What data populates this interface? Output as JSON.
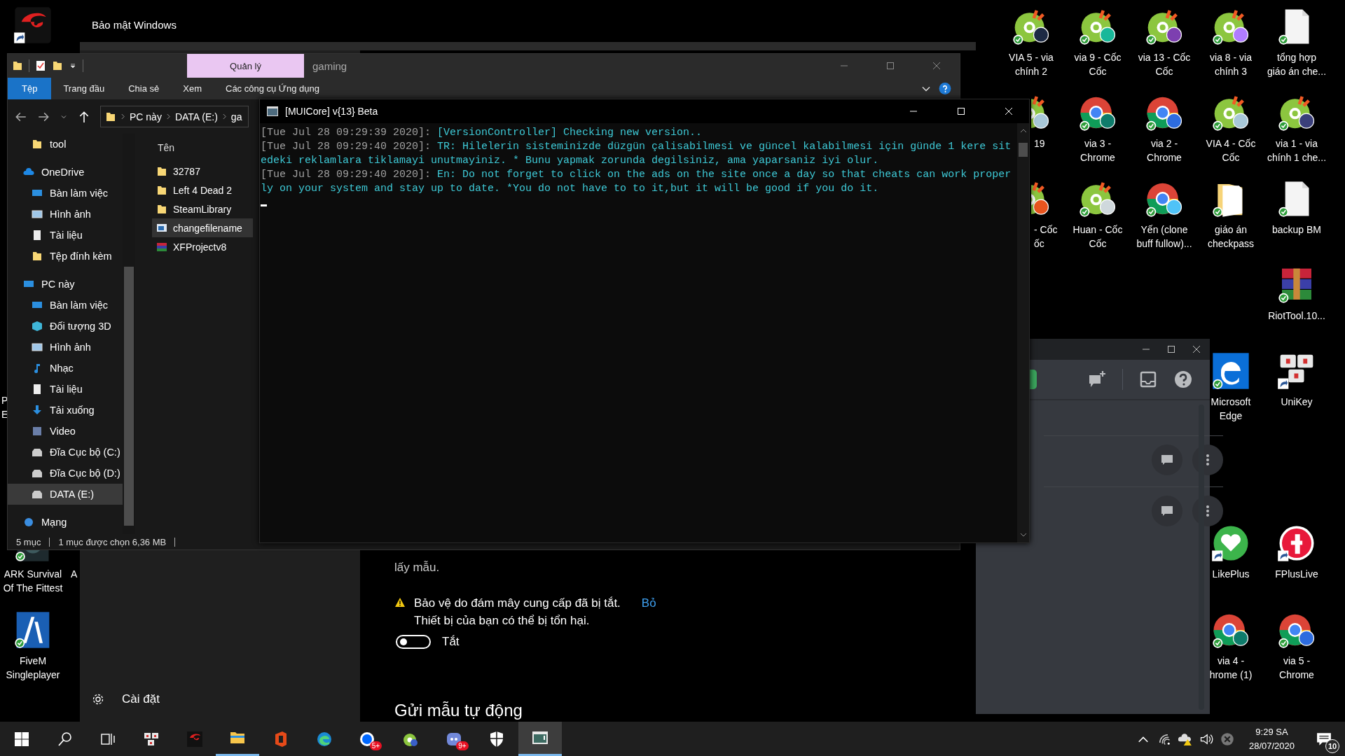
{
  "desktop_icons": [
    {
      "kind": "garena",
      "synced": false,
      "shortcut": true
    },
    {
      "kind": "coccoc",
      "synced": true,
      "shortcut": false,
      "lines": [
        "VIA 5 - via",
        "chính 2"
      ]
    },
    {
      "kind": "coccoc",
      "synced": true,
      "shortcut": false,
      "lines": [
        "via 9 - Cốc",
        "Cốc"
      ]
    },
    {
      "kind": "coccoc",
      "synced": true,
      "shortcut": false,
      "lines": [
        "via 13 - Cốc",
        "Cốc"
      ]
    },
    {
      "kind": "coccoc",
      "synced": true,
      "shortcut": false,
      "lines": [
        "via 8 - via",
        "chính 3"
      ]
    },
    {
      "kind": "doc",
      "synced": true,
      "shortcut": false,
      "lines": [
        "tổng hợp",
        "giáo án che..."
      ]
    },
    {
      "kind": "coccoc",
      "lines": [
        "19"
      ]
    },
    {
      "kind": "chrome",
      "synced": true,
      "shortcut": false,
      "lines": [
        "via 3 -",
        "Chrome"
      ]
    },
    {
      "kind": "chrome",
      "synced": true,
      "shortcut": false,
      "lines": [
        "via 2 -",
        "Chrome"
      ]
    },
    {
      "kind": "coccoc",
      "synced": true,
      "shortcut": false,
      "lines": [
        "VIA 4 - Cốc",
        "Cốc"
      ]
    },
    {
      "kind": "coccoc",
      "synced": true,
      "shortcut": false,
      "lines": [
        "via 1 - via",
        "chính 1 che..."
      ]
    },
    {
      "kind": "coccoc",
      "lines": [
        "- Cốc",
        "ốc"
      ]
    },
    {
      "kind": "coccoc",
      "synced": true,
      "shortcut": false,
      "lines": [
        "Huan - Cốc",
        "Cốc"
      ]
    },
    {
      "kind": "chrome",
      "synced": true,
      "shortcut": false,
      "lines": [
        "Yến (clone",
        "buff fullow)..."
      ]
    },
    {
      "kind": "folder",
      "synced": true,
      "shortcut": false,
      "lines": [
        "giáo án",
        "checkpass"
      ]
    },
    {
      "kind": "doc",
      "synced": true,
      "shortcut": false,
      "lines": [
        "backup BM"
      ]
    },
    {
      "kind": "winrar",
      "synced": true,
      "shortcut": false,
      "lines": [
        "RiotTool.10..."
      ]
    },
    {
      "kind": "edge",
      "synced": true,
      "shortcut": false,
      "lines": [
        "Microsoft",
        "Edge"
      ]
    },
    {
      "kind": "unikey",
      "synced": false,
      "shortcut": true,
      "lines": [
        "UniKey"
      ]
    },
    {
      "kind": "likeplus",
      "synced": false,
      "shortcut": true,
      "lines": [
        "LikePlus"
      ]
    },
    {
      "kind": "fplus",
      "synced": false,
      "shortcut": true,
      "lines": [
        "FPlusLive"
      ]
    },
    {
      "kind": "chrome",
      "synced": true,
      "shortcut": false,
      "lines": [
        "via 4 -",
        "hrome (1)"
      ]
    },
    {
      "kind": "chrome",
      "synced": true,
      "shortcut": false,
      "lines": [
        "via 5 -",
        "Chrome"
      ]
    },
    {
      "kind": "ark",
      "synced": true,
      "shortcut": false,
      "lines": [
        "ARK Survival",
        "Of The Fittest"
      ]
    },
    {
      "kind": "fivem",
      "synced": true,
      "shortcut": false,
      "lines": [
        "FiveM",
        "Singleplayer"
      ]
    },
    {
      "kind": "label",
      "lines": [
        "A"
      ]
    },
    {
      "kind": "label",
      "lines": [
        "P",
        "E"
      ]
    }
  ],
  "defender": {
    "title": "Bảo mật Windows",
    "settings": "Cài đặt",
    "text": "lấy mẫu.",
    "warning": [
      "Bảo vệ do đám mây cung cấp đã bị tắt.",
      "Thiết bị của bạn có thể bị tổn hại."
    ],
    "action": "Bỏ",
    "toggle": {
      "on": false,
      "label": "Tắt"
    },
    "heading": "Gửi mẫu tự động"
  },
  "explorer": {
    "context_tab": "Quản lý",
    "title": "gaming",
    "ribbon_tabs": [
      {
        "label": "Tệp",
        "selected": true
      },
      {
        "label": "Trang đầu",
        "selected": false
      },
      {
        "label": "Chia sẻ",
        "selected": false
      },
      {
        "label": "Xem",
        "selected": false
      },
      {
        "label": "Các công cụ Ứng dụng",
        "selected": false
      }
    ],
    "path": [
      "PC này",
      "DATA (E:)",
      "ga"
    ],
    "nav": [
      {
        "label": "tool",
        "kind": "folder",
        "selected": false,
        "top": false
      },
      {
        "label": "OneDrive",
        "kind": "cloud",
        "selected": false,
        "top": true
      },
      {
        "label": "Bàn làm việc",
        "kind": "desktop",
        "selected": false,
        "top": false
      },
      {
        "label": "Hình ảnh",
        "kind": "picture",
        "selected": false,
        "top": false
      },
      {
        "label": "Tài liệu",
        "kind": "doc",
        "selected": false,
        "top": false
      },
      {
        "label": "Tệp đính kèm",
        "kind": "folder",
        "selected": false,
        "top": false
      },
      {
        "label": "PC này",
        "kind": "pc",
        "selected": false,
        "top": true
      },
      {
        "label": "Bàn làm việc",
        "kind": "desktop",
        "selected": false,
        "top": false
      },
      {
        "label": "Đối tượng 3D",
        "kind": "cube",
        "selected": false,
        "top": false
      },
      {
        "label": "Hình ảnh",
        "kind": "picture",
        "selected": false,
        "top": false
      },
      {
        "label": "Nhạc",
        "kind": "music",
        "selected": false,
        "top": false
      },
      {
        "label": "Tài liệu",
        "kind": "doc",
        "selected": false,
        "top": false
      },
      {
        "label": "Tải xuống",
        "kind": "download",
        "selected": false,
        "top": false
      },
      {
        "label": "Video",
        "kind": "video",
        "selected": false,
        "top": false
      },
      {
        "label": "Đĩa Cục bộ (C:)",
        "kind": "drive",
        "selected": false,
        "top": false
      },
      {
        "label": "Đĩa Cục bộ (D:)",
        "kind": "drive",
        "selected": false,
        "top": false
      },
      {
        "label": "DATA (E:)",
        "kind": "drive",
        "selected": true,
        "top": false
      },
      {
        "label": "Mạng",
        "kind": "network",
        "selected": false,
        "top": true
      }
    ],
    "column": "Tên",
    "files": [
      {
        "name": "32787",
        "kind": "folder",
        "selected": false
      },
      {
        "name": "Left 4 Dead 2",
        "kind": "folder",
        "selected": false
      },
      {
        "name": "SteamLibrary",
        "kind": "folder",
        "selected": false
      },
      {
        "name": "changefilename",
        "kind": "app",
        "selected": true
      },
      {
        "name": "XFProjectv8",
        "kind": "archive",
        "selected": false
      }
    ],
    "status": [
      "5 mục",
      "1 mục được chọn  6,36 MB"
    ]
  },
  "console": {
    "title": "[MUICore] v{13} Beta",
    "log": [
      {
        "time": "[Tue Jul 28 09:29:39 2020]:",
        "message": "[VersionController] Checking new version.."
      },
      {
        "time": "[Tue Jul 28 09:29:40 2020]:",
        "message": "TR: Hilelerin sisteminizde düzgün çalisabilmesi ve güncel kalabilmesi için günde 1 kere sitedeki reklamlara tiklamayi unutmayiniz. * Bunu yapmak zorunda degilsiniz, ama yaparsaniz iyi olur."
      },
      {
        "time": "[Tue Jul 28 09:29:40 2020]:",
        "message": "En: Do not forget to click on the ads on the site once a day so that cheats can work properly on your system and stay up to date. *You do not have to to it,but it will be good if you do it."
      }
    ]
  },
  "taskbar": {
    "apps": [
      {
        "kind": "start",
        "running": false,
        "selected": false
      },
      {
        "kind": "search",
        "running": false,
        "selected": false
      },
      {
        "kind": "taskview",
        "running": false,
        "selected": false
      },
      {
        "kind": "unikey",
        "running": false,
        "selected": false
      },
      {
        "kind": "garena",
        "running": false,
        "selected": false
      },
      {
        "kind": "explorer",
        "running": true,
        "selected": false
      },
      {
        "kind": "office",
        "running": false,
        "selected": false
      },
      {
        "kind": "edge",
        "running": false,
        "selected": false
      },
      {
        "kind": "zalo",
        "running": false,
        "selected": false,
        "badge": "5+"
      },
      {
        "kind": "coccoc",
        "running": false,
        "selected": false
      },
      {
        "kind": "discord",
        "running": false,
        "selected": false,
        "badge": "9+"
      },
      {
        "kind": "defender",
        "running": false,
        "selected": false
      },
      {
        "kind": "console",
        "running": true,
        "selected": true
      }
    ],
    "time": "9:29 SA",
    "date": "28/07/2020",
    "notifications": "10"
  }
}
